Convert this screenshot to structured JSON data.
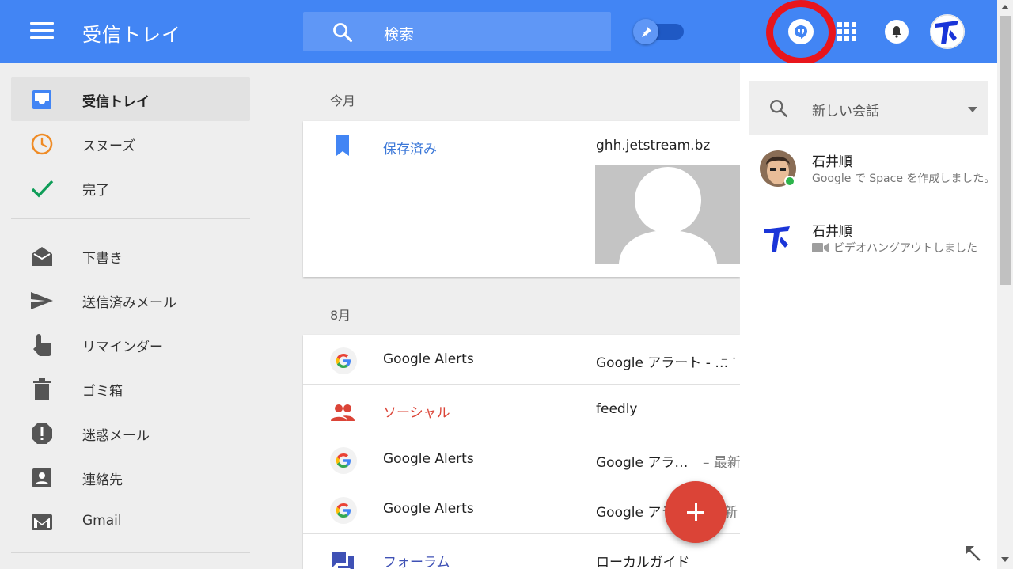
{
  "header": {
    "title": "受信トレイ",
    "search_placeholder": "検索"
  },
  "sidebar": {
    "items": [
      {
        "label": "受信トレイ"
      },
      {
        "label": "スヌーズ"
      },
      {
        "label": "完了"
      },
      {
        "label": "下書き"
      },
      {
        "label": "送信済みメール"
      },
      {
        "label": "リマインダー"
      },
      {
        "label": "ゴミ箱"
      },
      {
        "label": "迷惑メール"
      },
      {
        "label": "連絡先"
      },
      {
        "label": "Gmail"
      }
    ]
  },
  "main": {
    "sections": [
      {
        "label": "今月",
        "rows": [
          {
            "sender": "保存済み",
            "subject": "ghh.jetstream.bz",
            "snippet": ""
          }
        ]
      },
      {
        "label": "8月",
        "rows": [
          {
            "sender": "Google Alerts",
            "subject": "Google アラート - …",
            "snippet": " – ·"
          },
          {
            "sender": "ソーシャル",
            "subject": "feedly",
            "snippet": ""
          },
          {
            "sender": "Google Alerts",
            "subject": "Google アラ…",
            "snippet": "– 最新"
          },
          {
            "sender": "Google Alerts",
            "subject": "Google アラ",
            "snippet": "最新"
          },
          {
            "sender": "フォーラム",
            "subject": "ローカルガイド",
            "snippet": ""
          }
        ]
      }
    ]
  },
  "hangouts": {
    "new_conversation_label": "新しい会話",
    "conversations": [
      {
        "name": "石井順",
        "preview": "Google で Space を作成しました。"
      },
      {
        "name": "石井順",
        "preview": "ビデオハングアウトしました"
      }
    ]
  },
  "colors": {
    "header": "#4285f4",
    "accent_red": "#db4437",
    "link_blue": "#3c78d8",
    "online_green": "#2cb44b",
    "highlight_ring": "#e8151c"
  }
}
